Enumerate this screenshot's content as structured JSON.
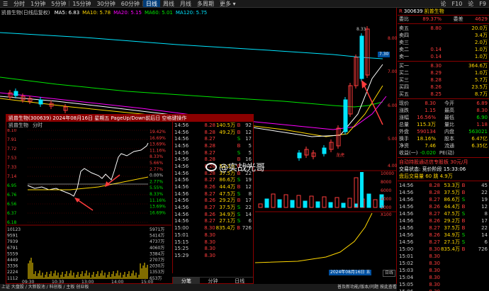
{
  "toolbar": {
    "items": [
      "分时",
      "1分钟",
      "5分钟",
      "15分钟",
      "30分钟",
      "60分钟",
      "日线",
      "周线",
      "月线",
      "多周期",
      "更多 ▾"
    ],
    "active_index": 6,
    "icons": [
      "论",
      "F10",
      "论",
      "F9"
    ]
  },
  "main_chart": {
    "stock_label": "凯普生物(日线后复权)",
    "ma_legend": [
      {
        "text": "MA5: 6.83",
        "color": "#ffffff"
      },
      {
        "text": "MA10: 5.78",
        "color": "#ffd700"
      },
      {
        "text": "MA20: 5.15",
        "color": "#ff00ff"
      },
      {
        "text": "MA60: 5.01",
        "color": "#00e600"
      },
      {
        "text": "MA120: 5.75",
        "color": "#00e5ff"
      }
    ],
    "high_label": "8.33",
    "current_price": "7.30",
    "lhb_label": "龙虎",
    "date_label": "2024年08月16日 五",
    "period_tag": "日线",
    "axis_labels": [
      "8.00",
      "7.00",
      "6.00",
      "5.00",
      "4.00"
    ],
    "vol_labels": [
      "10000",
      "8000",
      "6000",
      "4000",
      "2000",
      "X100"
    ],
    "colors": {
      "up": "#ff3c3c",
      "down": "#00e5ff",
      "ma5": "#ffffff",
      "ma10": "#ffd700",
      "ma20": "#ff00ff",
      "ma60": "#00e600",
      "ma120": "#00e5ff"
    }
  },
  "right_panel": {
    "code": "300639",
    "name": "凯普生物",
    "webi_label": "委比",
    "webi_val": "89.37%",
    "weicha_label": "委差",
    "weicha_val": "4629",
    "sells": [
      {
        "label": "卖五",
        "price": "",
        "vol": ""
      },
      {
        "label": "卖四",
        "price": "",
        "vol": ""
      },
      {
        "label": "卖三",
        "price": "",
        "vol": ""
      },
      {
        "label": "卖二",
        "price": "0.14",
        "vol": "1.0万"
      },
      {
        "label": "卖一",
        "price": "0.14",
        "vol": "1.0万"
      }
    ],
    "sell_top_price": "8.80",
    "sell_top_vol": "20.0万",
    "sell_v2": "3.4万",
    "sell_v3": "2.0万",
    "buys": [
      {
        "label": "买一",
        "price": "8.30",
        "vol": "364.6万"
      },
      {
        "label": "买二",
        "price": "8.29",
        "vol": "1.0万"
      },
      {
        "label": "买三",
        "price": "8.28",
        "vol": "5.7万"
      },
      {
        "label": "买四",
        "price": "8.26",
        "vol": "23.5万"
      },
      {
        "label": "买五",
        "price": "8.25",
        "vol": "8.7万"
      }
    ],
    "stats": [
      {
        "k": "现价",
        "v": "8.30",
        "vc": "red",
        "k2": "今开",
        "v2": "6.89",
        "v2c": "red"
      },
      {
        "k": "涨跌",
        "v": "1.15",
        "vc": "red",
        "k2": "最高",
        "v2": "8.30",
        "v2c": "red"
      },
      {
        "k": "涨幅",
        "v": "16.56%",
        "vc": "red",
        "k2": "最低",
        "v2": "6.90",
        "v2c": "green"
      },
      {
        "k": "总量",
        "v": "115.3万",
        "vc": "yellow",
        "k2": "量比",
        "v2": "1.18",
        "v2c": "red"
      },
      {
        "k": "外盘",
        "v": "590134",
        "vc": "red",
        "k2": "内盘",
        "v2": "563021",
        "v2c": "green"
      },
      {
        "k": "换手",
        "v": "18.16%",
        "vc": "yellow",
        "k2": "股本",
        "v2": "6.47亿",
        "v2c": "yellow"
      },
      {
        "k": "净资",
        "v": "7.46",
        "vc": "yellow",
        "k2": "流通",
        "v2": "6.35亿",
        "v2c": "yellow"
      },
      {
        "k": "收益(一)",
        "v": "-0.020",
        "vc": "green",
        "k2": "PE(动)",
        "v2": "",
        "v2c": "yellow"
      }
    ],
    "info_lines": [
      {
        "text": "自动持股通达信专股板 30元/月",
        "color": "red"
      },
      {
        "text": "交易状态:  竞价阶段 15:33:06",
        "color": "white"
      },
      {
        "text": "盘后交易量 60 跳 4.9万",
        "color": "yellow"
      }
    ],
    "ticks": [
      {
        "t": "14:56",
        "p": "8.28",
        "v": "53.3万",
        "bs": "B",
        "n": "45"
      },
      {
        "t": "14:56",
        "p": "8.28",
        "v": "37.5万",
        "bs": "B",
        "n": "22"
      },
      {
        "t": "14:56",
        "p": "8.27",
        "v": "86.6万",
        "bs": "S",
        "n": "19"
      },
      {
        "t": "14:56",
        "p": "8.26",
        "v": "44.4万",
        "bs": "B",
        "n": "12"
      },
      {
        "t": "14:56",
        "p": "8.27",
        "v": "47.5万",
        "bs": "S",
        "n": "8"
      },
      {
        "t": "14:56",
        "p": "8.26",
        "v": "29.2万",
        "bs": "B",
        "n": "17"
      },
      {
        "t": "14:56",
        "p": "8.27",
        "v": "37.5万",
        "bs": "B",
        "n": "22"
      },
      {
        "t": "14:56",
        "p": "8.26",
        "v": "34.9万",
        "bs": "S",
        "n": "14"
      },
      {
        "t": "14:56",
        "p": "8.27",
        "v": "27.1万",
        "bs": "S",
        "n": "6"
      },
      {
        "t": "15:00",
        "p": "8.30",
        "v": "835.4万",
        "bs": "B",
        "n": "726"
      },
      {
        "t": "15:01",
        "p": "8.30",
        "v": "",
        "bs": "",
        "n": ""
      },
      {
        "t": "15:02",
        "p": "8.30",
        "v": "",
        "bs": "",
        "n": ""
      },
      {
        "t": "15:03",
        "p": "8.30",
        "v": "",
        "bs": "",
        "n": ""
      },
      {
        "t": "15:04",
        "p": "8.30",
        "v": "",
        "bs": "",
        "n": ""
      },
      {
        "t": "15:05",
        "p": "8.30",
        "v": "",
        "bs": "",
        "n": ""
      },
      {
        "t": "15:06",
        "p": "8.30",
        "v": "",
        "bs": "",
        "n": ""
      }
    ]
  },
  "popup": {
    "title": "凯普生物(300639) 2024年08月16日 星期五 PageUp/Down前后日 空格键操作",
    "head_name": "凯普生物",
    "head_tab": "分时",
    "price_labels": [
      "8.10",
      "7.91",
      "7.72",
      "7.53",
      "7.33",
      "7.14",
      "6.95",
      "6.76",
      "6.56",
      "6.37",
      "6.18"
    ],
    "pct_labels": [
      "19.42%",
      "16.69%",
      "13.69%",
      "11.16%",
      "8.33%",
      "5.66%",
      "2.77%",
      "0.00%",
      "2.77%",
      "5.55%",
      "8.33%",
      "11.16%",
      "13.69%",
      "16.69%"
    ],
    "vol_labels": [
      "10123",
      "9591",
      "7939",
      "6791",
      "5559",
      "4449",
      "3336",
      "2224",
      "1112"
    ],
    "vol_pct_labels": [
      "5971万",
      "5414万",
      "4737万",
      "4060万",
      "3384万",
      "2707万",
      "2030万",
      "1353万",
      "653万"
    ],
    "time_labels": [
      "09:30",
      "10:30",
      "13:00",
      "14:00",
      "15:00"
    ],
    "ticks": [
      {
        "t": "14:56",
        "p": "8.28",
        "v": "140.5万",
        "bs": "B",
        "n": "92"
      },
      {
        "t": "14:56",
        "p": "8.28",
        "v": "49.2万",
        "bs": "B",
        "n": "12"
      },
      {
        "t": "14:56",
        "p": "8.27",
        "v": "",
        "bs": "S",
        "n": "17"
      },
      {
        "t": "14:56",
        "p": "8.28",
        "v": "",
        "bs": "B",
        "n": "5"
      },
      {
        "t": "14:56",
        "p": "8.27",
        "v": "",
        "bs": "S",
        "n": "5"
      },
      {
        "t": "14:56",
        "p": "8.28",
        "v": "",
        "bs": "B",
        "n": "16"
      },
      {
        "t": "14:56",
        "p": "8.28",
        "v": "53.3万",
        "bs": "B",
        "n": "45"
      },
      {
        "t": "14:56",
        "p": "8.28",
        "v": "37.5万",
        "bs": "B",
        "n": "22"
      },
      {
        "t": "14:56",
        "p": "8.27",
        "v": "86.6万",
        "bs": "S",
        "n": "19"
      },
      {
        "t": "14:56",
        "p": "8.26",
        "v": "44.4万",
        "bs": "B",
        "n": "12"
      },
      {
        "t": "14:56",
        "p": "8.27",
        "v": "47.5万",
        "bs": "S",
        "n": "8"
      },
      {
        "t": "14:56",
        "p": "8.26",
        "v": "29.2万",
        "bs": "B",
        "n": "17"
      },
      {
        "t": "14:56",
        "p": "8.27",
        "v": "37.5万",
        "bs": "S",
        "n": "22"
      },
      {
        "t": "14:56",
        "p": "8.26",
        "v": "34.9万",
        "bs": "S",
        "n": "14"
      },
      {
        "t": "14:56",
        "p": "8.27",
        "v": "27.1万",
        "bs": "S",
        "n": "6"
      },
      {
        "t": "15:00",
        "p": "8.30",
        "v": "835.4万",
        "bs": "B",
        "n": "726"
      },
      {
        "t": "15:01",
        "p": "8.30",
        "v": "",
        "bs": "",
        "n": ""
      },
      {
        "t": "15:15",
        "p": "8.30",
        "v": "",
        "bs": "",
        "n": ""
      },
      {
        "t": "15:25",
        "p": "8.30",
        "v": "",
        "bs": "",
        "n": ""
      },
      {
        "t": "15:29",
        "p": "8.30",
        "v": "",
        "bs": "",
        "n": ""
      }
    ],
    "tabs": [
      "分笔",
      "分钟",
      "日线"
    ],
    "active_tab": 0
  },
  "watermark": "@实战光哥",
  "statusbar": {
    "left": "上证 大盘股 / 大新股池 / 科创板 / 主板 创业板",
    "right": "普及新功能/版本/问题 按此查看"
  }
}
